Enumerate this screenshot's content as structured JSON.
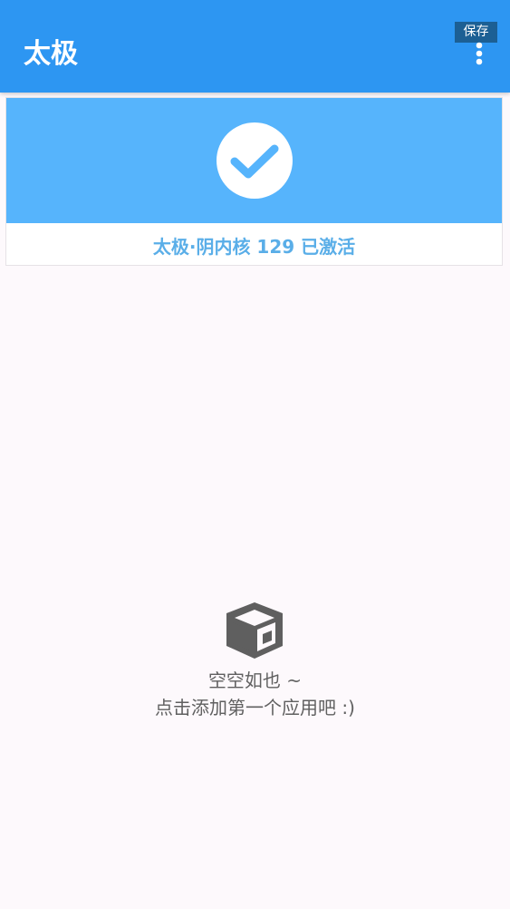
{
  "appbar": {
    "title": "太极",
    "save_badge": "保存",
    "more_icon": "more-vert-icon"
  },
  "status": {
    "icon": "check-circle-icon",
    "text": "太极·阴内核 129 已激活",
    "banner_color": "#56b4fc",
    "text_color": "#5aaee8"
  },
  "empty_state": {
    "icon": "open-box-icon",
    "line1": "空空如也 ~",
    "line2": "点击添加第一个应用吧 :)"
  },
  "colors": {
    "primary": "#2d96f2",
    "background": "#fdf9fc"
  }
}
